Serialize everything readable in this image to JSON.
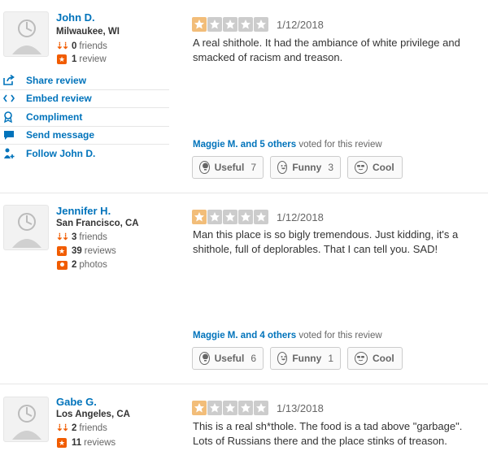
{
  "colors": {
    "accent": "#0073bb",
    "orange": "#f15c00",
    "star_on": "#f2bd79",
    "star_off": "#cccccc"
  },
  "action_icons": [
    "share-icon",
    "embed-icon",
    "compliment-icon",
    "message-icon",
    "follow-icon"
  ],
  "reviews": [
    {
      "user": {
        "name": "John D.",
        "location": "Milwaukee, WI",
        "friends": "0",
        "friends_label": "friends",
        "reviews": "1",
        "reviews_label": "review"
      },
      "actions": [
        "Share review",
        "Embed review",
        "Compliment",
        "Send message",
        "Follow John D."
      ],
      "rating": 1,
      "date": "1/12/2018",
      "text": "A real shithole. It had the ambiance of white privilege and smacked of racism and treason.",
      "voted_names": "Maggie M. and 5 others",
      "voted_suffix": "voted for this review",
      "votes": {
        "useful_label": "Useful",
        "useful": "7",
        "funny_label": "Funny",
        "funny": "3",
        "cool_label": "Cool"
      }
    },
    {
      "user": {
        "name": "Jennifer H.",
        "location": "San Francisco, CA",
        "friends": "3",
        "friends_label": "friends",
        "reviews": "39",
        "reviews_label": "reviews",
        "photos": "2",
        "photos_label": "photos"
      },
      "rating": 1,
      "date": "1/12/2018",
      "text": "Man this place is so bigly tremendous. Just kidding, it's a shithole, full of deplorables. That I can tell you. SAD!",
      "voted_names": "Maggie M. and 4 others",
      "voted_suffix": "voted for this review",
      "votes": {
        "useful_label": "Useful",
        "useful": "6",
        "funny_label": "Funny",
        "funny": "1",
        "cool_label": "Cool"
      }
    },
    {
      "user": {
        "name": "Gabe G.",
        "location": "Los Angeles, CA",
        "friends": "2",
        "friends_label": "friends",
        "reviews": "11",
        "reviews_label": "reviews"
      },
      "rating": 1,
      "date": "1/13/2018",
      "text": "This is a real sh*thole. The food is a tad above \"garbage\". Lots of Russians there and the place stinks of treason."
    }
  ]
}
